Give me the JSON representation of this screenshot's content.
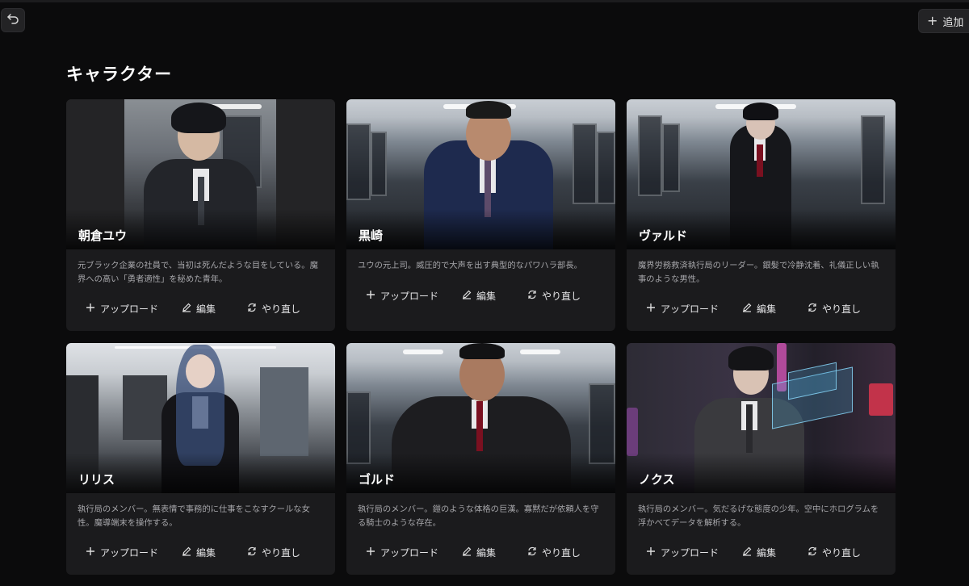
{
  "toolbar": {
    "back_icon": "undo-icon",
    "add_label": "追加",
    "add_icon": "plus-icon"
  },
  "page": {
    "title": "キャラクター"
  },
  "actions": {
    "upload": "アップロード",
    "edit": "編集",
    "redo": "やり直し"
  },
  "characters": [
    {
      "name": "朝倉ユウ",
      "description": "元ブラック企業の社員で、当初は死んだような目をしている。魔界への高い「勇者適性」を秘めた青年。",
      "image": "portrait-dark"
    },
    {
      "name": "黒崎",
      "description": "ユウの元上司。威圧的で大声を出す典型的なパワハラ部長。",
      "image": "train-interior"
    },
    {
      "name": "ヴァルド",
      "description": "魔界労務救済執行局のリーダー。銀髪で冷静沈着、礼儀正しい執事のような男性。",
      "image": "train-interior"
    },
    {
      "name": "リリス",
      "description": "執行局のメンバー。無表情で事務的に仕事をこなすクールな女性。魔導端末を操作する。",
      "image": "office"
    },
    {
      "name": "ゴルド",
      "description": "執行局のメンバー。鎧のような体格の巨漢。寡黙だが依頼人を守る騎士のような存在。",
      "image": "train-interior"
    },
    {
      "name": "ノクス",
      "description": "執行局のメンバー。気だるげな態度の少年。空中にホログラムを浮かべてデータを解析する。",
      "image": "neon-alley"
    }
  ]
}
